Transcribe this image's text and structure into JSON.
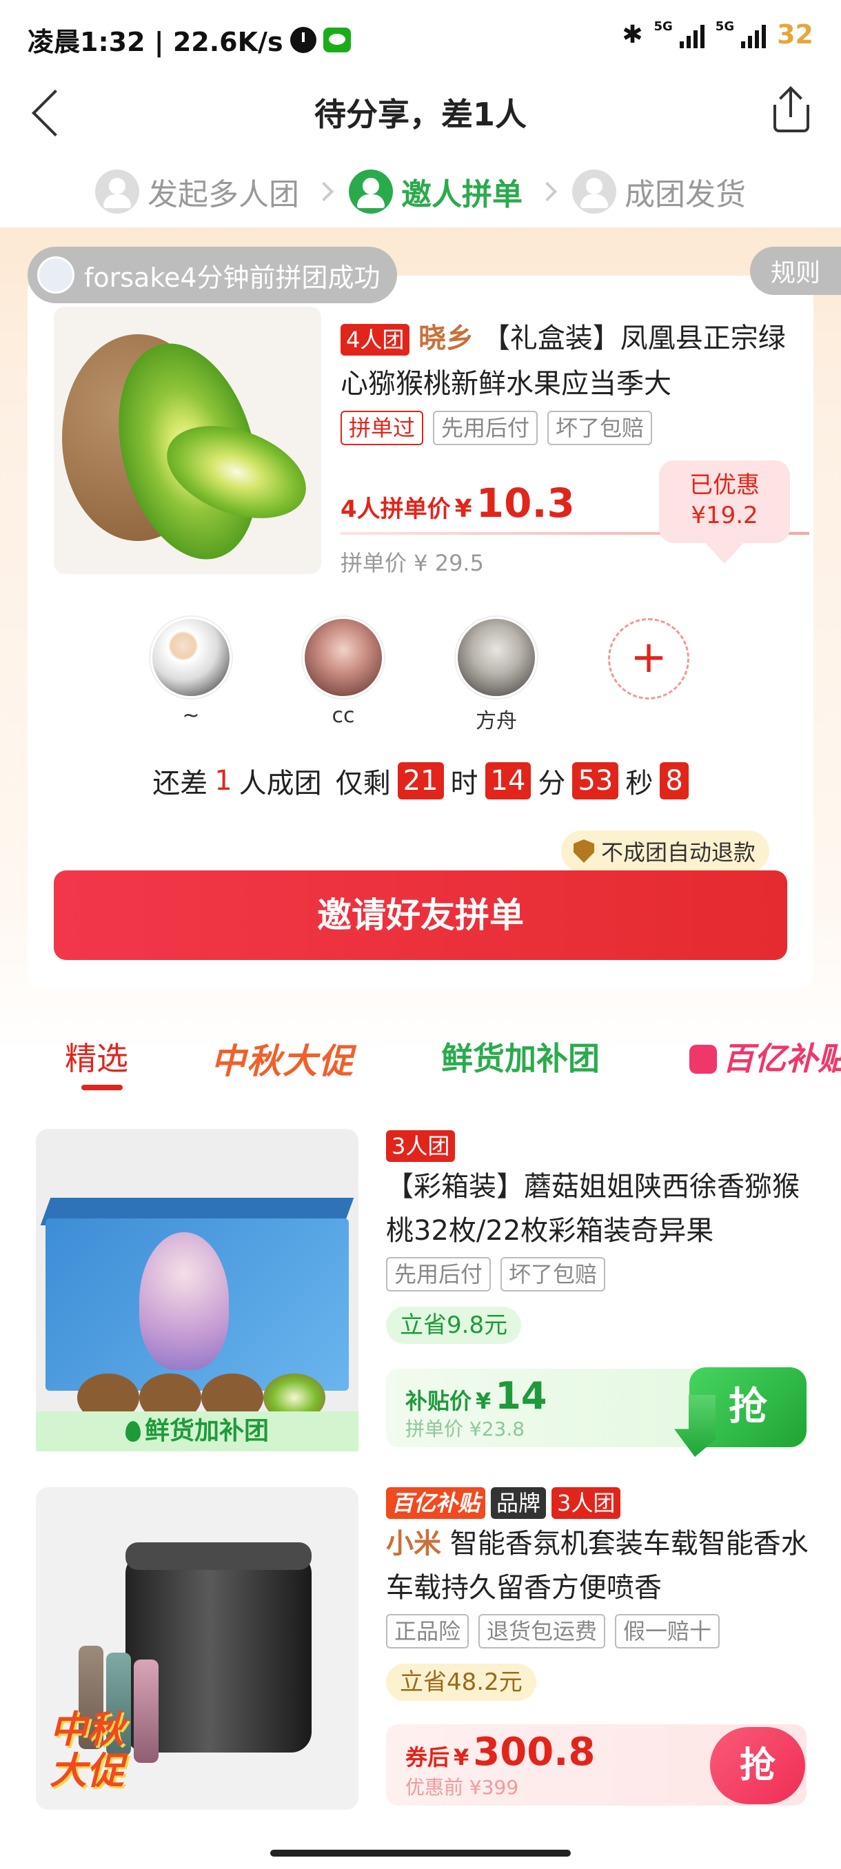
{
  "status_bar": {
    "time": "凌晨1:32 | 22.6K/s",
    "net1": "5G",
    "net2": "5G",
    "battery": "32"
  },
  "nav": {
    "title": "待分享，差1人"
  },
  "steps": [
    {
      "label": "发起多人团",
      "state": "done"
    },
    {
      "label": "邀人拼单",
      "state": "active"
    },
    {
      "label": "成团发货",
      "state": "todo"
    }
  ],
  "notice": {
    "text": "forsake4分钟前拼团成功",
    "rules_label": "规则"
  },
  "product": {
    "group_tag": "4人团",
    "brand": "晓乡",
    "title": "【礼盒装】凤凰县正宗绿心猕猴桃新鲜水果应当季大",
    "chips": [
      "拼单过",
      "先用后付",
      "坏了包赔"
    ],
    "price_label": "4人拼单价",
    "currency": "¥",
    "price": "10.3",
    "orig_price": "拼单价 ¥ 29.5",
    "discount_label": "已优惠",
    "discount_value": "¥19.2"
  },
  "members": [
    {
      "name": "~"
    },
    {
      "name": "cc"
    },
    {
      "name": "方舟"
    }
  ],
  "countdown": {
    "prefix": "还差",
    "need": "1",
    "mid": "人成团",
    "remain": "仅剩",
    "hours": "21",
    "h": "时",
    "minutes": "14",
    "m": "分",
    "seconds": "53",
    "s": "秒",
    "tenths": "8"
  },
  "refund_badge": "不成团自动退款",
  "invite_button": "邀请好友拼单",
  "tabs": {
    "selected": "精选",
    "promo": "中秋大促",
    "fresh": "鲜货加补团",
    "subsidy": "百亿补贴"
  },
  "feed": [
    {
      "group_tag": "3人团",
      "title": "【彩箱装】蘑菇姐姐陕西徐香猕猴桃32枚/22枚彩箱装奇异果",
      "chips": [
        "先用后付",
        "坏了包赔"
      ],
      "image_label": "鲜货加补团",
      "save": "立省9.8元",
      "price_label": "补贴价",
      "currency": "¥",
      "price": "14",
      "sub_price": "拼单价 ¥23.8",
      "grab": "抢"
    },
    {
      "badge_subsidy": "百亿补贴",
      "badge_brand": "品牌",
      "group_tag": "3人团",
      "brand": "小米",
      "title": "智能香氛机套装车载智能香水车载持久留香方便喷香",
      "chips": [
        "正品险",
        "退货包运费",
        "假一赔十"
      ],
      "image_badge": "中秋大促",
      "save": "立省48.2元",
      "price_label": "券后",
      "currency": "¥",
      "price": "300.8",
      "sub_price": "优惠前 ¥399",
      "grab": "抢"
    }
  ],
  "colors": {
    "accent_red": "#e1251b",
    "green": "#2aab4b",
    "subsidy_pink": "#f0376a"
  }
}
